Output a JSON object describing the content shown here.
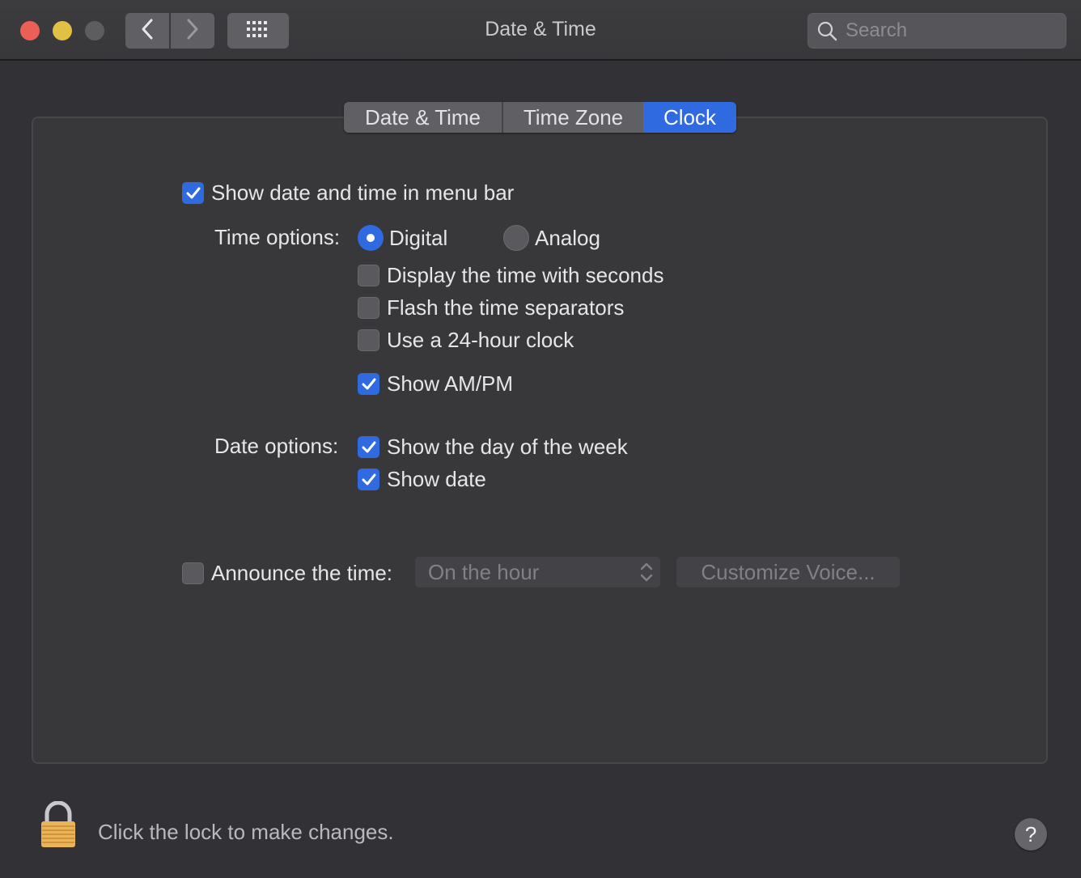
{
  "window": {
    "title": "Date & Time"
  },
  "toolbar": {
    "back_icon": "chevron-left-icon",
    "forward_icon": "chevron-right-icon",
    "grid_icon": "show-all-grid-icon"
  },
  "search": {
    "placeholder": "Search",
    "value": ""
  },
  "tabs": [
    {
      "label": "Date & Time",
      "selected": false
    },
    {
      "label": "Time Zone",
      "selected": false
    },
    {
      "label": "Clock",
      "selected": true
    }
  ],
  "clock": {
    "show_in_menubar": {
      "label": "Show date and time in menu bar",
      "checked": true
    },
    "time_options_label": "Time options:",
    "radio_digital": {
      "label": "Digital",
      "selected": true
    },
    "radio_analog": {
      "label": "Analog",
      "selected": false
    },
    "seconds": {
      "label": "Display the time with seconds",
      "checked": false
    },
    "flash": {
      "label": "Flash the time separators",
      "checked": false
    },
    "hour24": {
      "label": "Use a 24-hour clock",
      "checked": false
    },
    "ampm": {
      "label": "Show AM/PM",
      "checked": true
    },
    "date_options_label": "Date options:",
    "day_of_week": {
      "label": "Show the day of the week",
      "checked": true
    },
    "show_date": {
      "label": "Show date",
      "checked": true
    },
    "announce": {
      "label": "Announce the time:",
      "checked": false
    },
    "announce_interval": {
      "value": "On the hour",
      "enabled": false
    },
    "customize_voice": {
      "label": "Customize Voice...",
      "enabled": false
    }
  },
  "footer": {
    "lock_text": "Click the lock to make changes.",
    "help_label": "?"
  },
  "colors": {
    "accent": "#2f6ae0",
    "window_bg": "#323236",
    "close": "#ec5f57",
    "minimize": "#e2c043"
  }
}
